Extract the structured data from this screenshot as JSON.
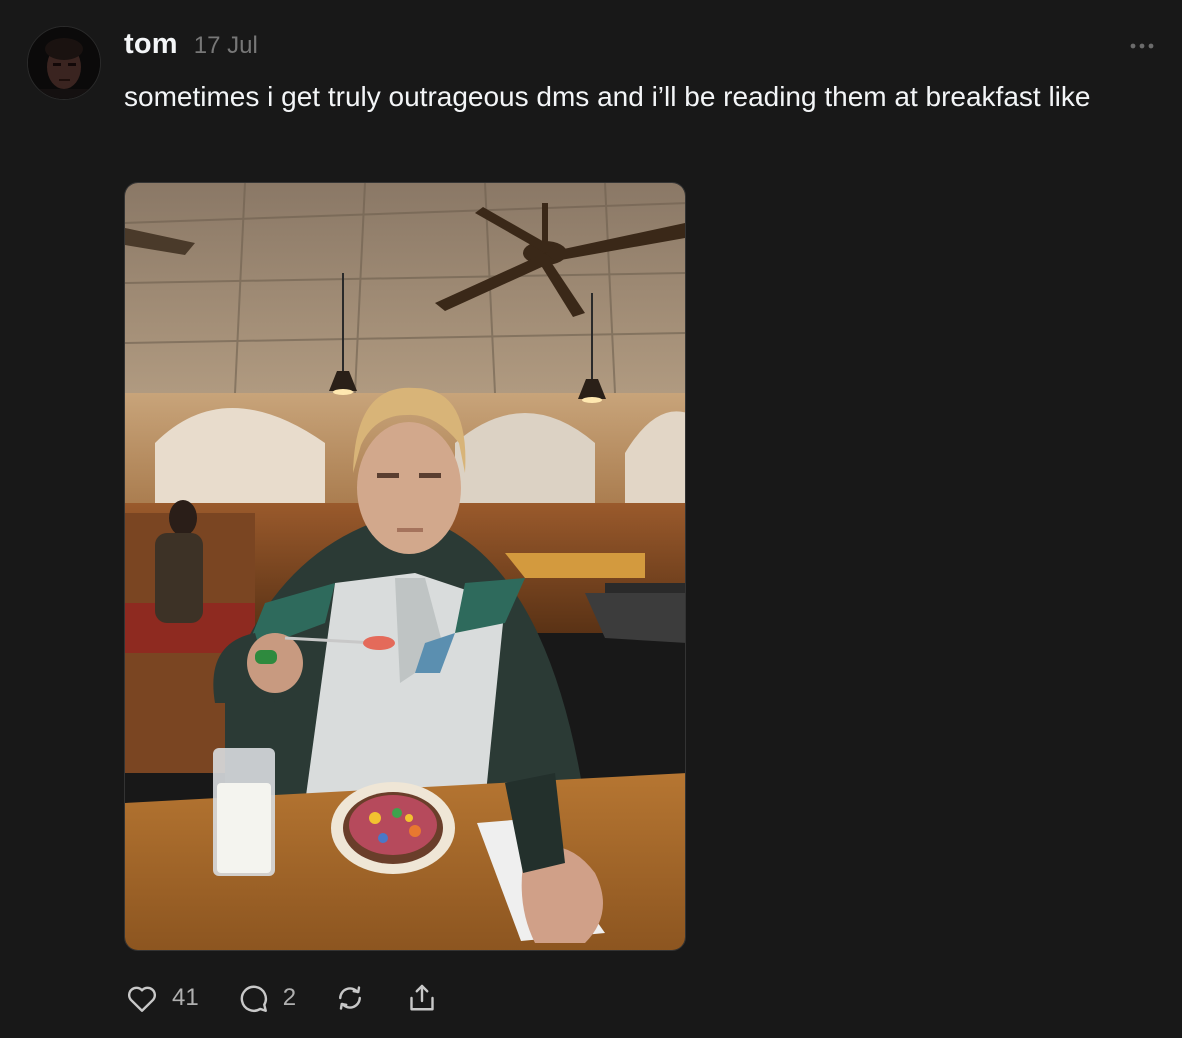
{
  "post": {
    "username": "tom",
    "timestamp": "17 Jul",
    "text": "sometimes i get truly outrageous dms and i’ll be reading them at breakfast like",
    "media_alt": "Man in a blond wig and superhero costume eating cereal in a diner"
  },
  "actions": {
    "likes": "41",
    "replies": "2"
  },
  "icons": {
    "more": "more-dots-icon",
    "like": "heart-icon",
    "reply": "comment-bubble-icon",
    "repost": "repost-icon",
    "share": "share-icon"
  },
  "colors": {
    "background": "#181818",
    "text": "#f3f5f7",
    "secondary": "#777777"
  }
}
